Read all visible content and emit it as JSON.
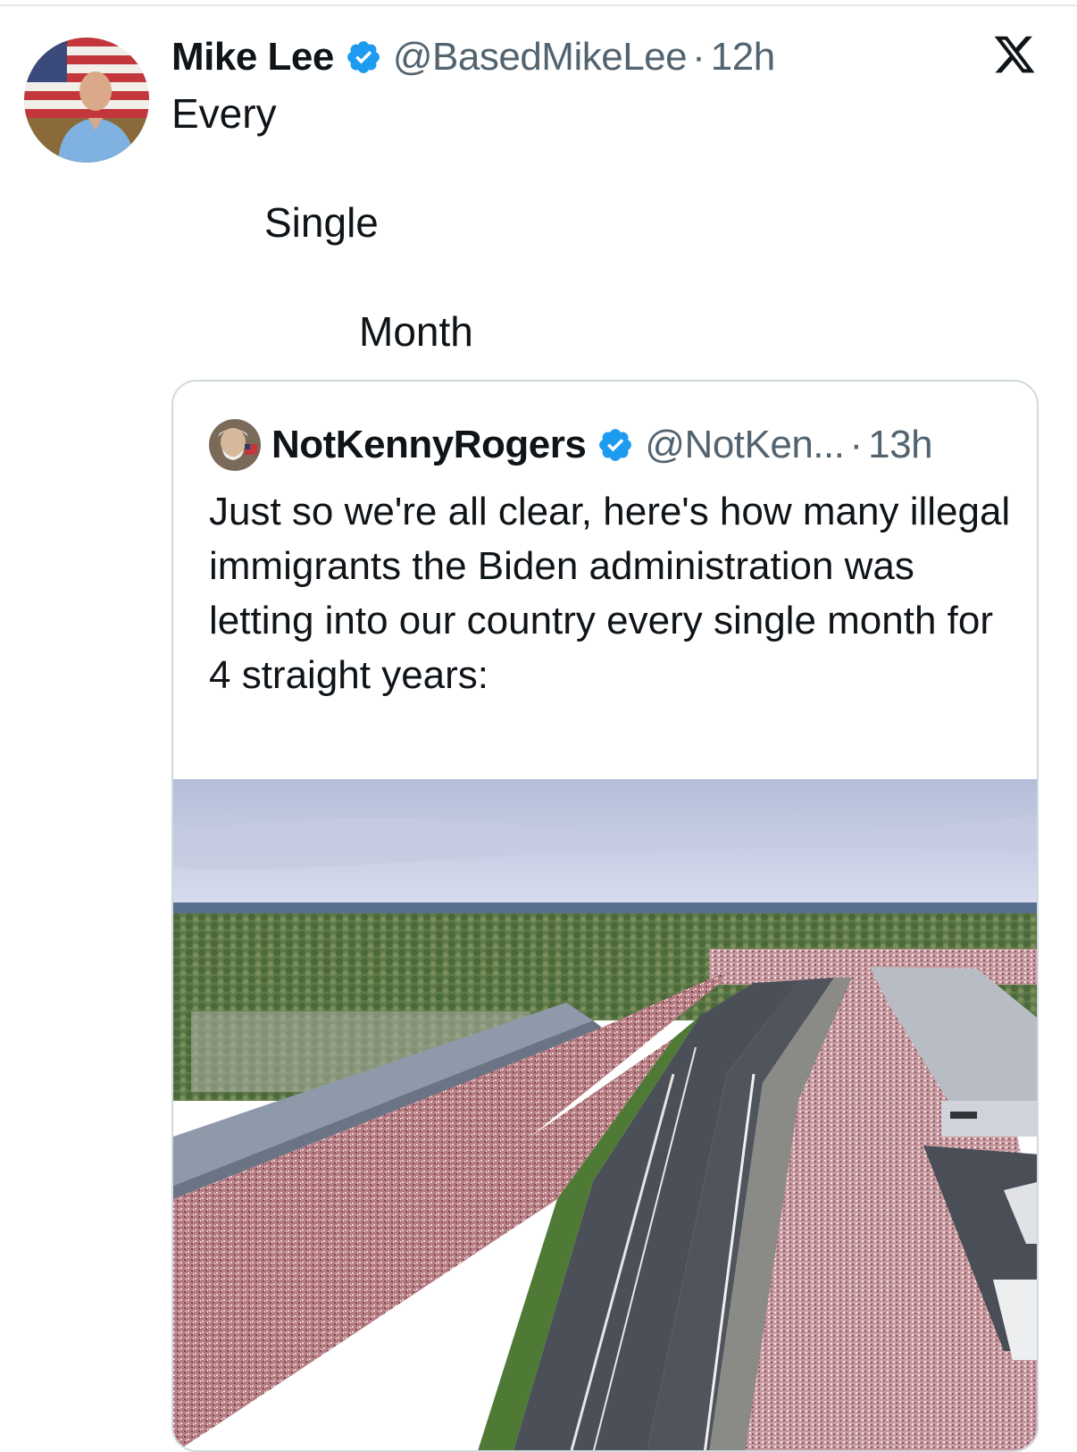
{
  "tweet": {
    "author_name": "Mike Lee",
    "handle": "@BasedMikeLee",
    "separator": "·",
    "time": "12h",
    "text_lines": [
      "Every",
      "Single",
      "Month"
    ]
  },
  "quoted_tweet": {
    "author_name": "NotKennyRogers",
    "handle": "@NotKen...",
    "separator": "·",
    "time": "13h",
    "text": "Just so we're all clear, here's how many illegal immigrants the Biden administration was letting into our country every single month for 4 straight years:"
  },
  "icons": {
    "verified": "verified-badge-icon",
    "platform": "x-logo-icon"
  },
  "colors": {
    "verified_blue": "#1d9bf0",
    "secondary_text": "#536471",
    "border": "#cfd9de"
  }
}
